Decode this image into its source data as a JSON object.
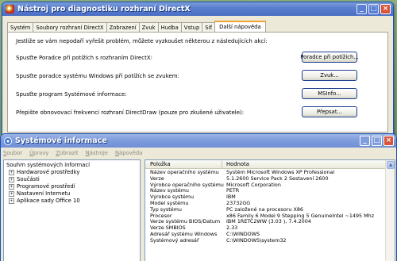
{
  "dx_window": {
    "title": "Nástroj pro diagnostiku rozhraní DirectX",
    "tabs": [
      "Systém",
      "Soubory rozhraní DirectX",
      "Zobrazení",
      "Zvuk",
      "Hudba",
      "Vstup",
      "Síť",
      "Další nápověda"
    ],
    "active_tab": "Další nápověda",
    "intro": "Jestliže se vám nepodaří vyřešit problém, můžete vyzkoušet některou z následujících akcí:",
    "rows": [
      {
        "label": "Spusťte Poradce při potížích s rozhraním DirectX:",
        "button": "Poradce při potížích..."
      },
      {
        "label": "Spusťte poradce systému Windows při potížích se zvukem:",
        "button": "Zvuk..."
      },
      {
        "label": "Spusťte program Systémové informace:",
        "button": "MSInfo..."
      },
      {
        "label": "Přepište obnovovací frekvenci rozhraní DirectDraw (pouze pro zkušené uživatele):",
        "button": "Přepsat..."
      }
    ]
  },
  "si_window": {
    "title": "Systémové informace",
    "menu": [
      "Soubor",
      "Úpravy",
      "Zobrazit",
      "Nástroje",
      "Nápověda"
    ],
    "tree": {
      "root": "Souhrn systémových informací",
      "children": [
        "Hardwarové prostředky",
        "Součásti",
        "Programové prostředí",
        "Nastavení Internetu",
        "Aplikace sady Office 10"
      ]
    },
    "columns": [
      "Položka",
      "Hodnota"
    ],
    "rows": [
      [
        "Název operačního systému",
        "Systém Microsoft Windows XP Professional"
      ],
      [
        "Verze",
        "5.1.2600 Service Pack 2 Sestavení 2600"
      ],
      [
        "Výrobce operačního systému",
        "Microsoft Corporation"
      ],
      [
        "Název systému",
        "PETR"
      ],
      [
        "Výrobce systému",
        "IBM"
      ],
      [
        "Model systému",
        "23732GG"
      ],
      [
        "Typ systému",
        "PC založené na procesoru X86"
      ],
      [
        "Procesor",
        "x86 Family 6 Model 9 Stepping 5 GenuineIntel ~1495 Mhz"
      ],
      [
        "Verze systému BIOS/Datum",
        "IBM 1RETC2WW (3.03 ), 7.4.2004"
      ],
      [
        "Verze SMBIOS",
        "2.33"
      ],
      [
        "Adresář systému Windows",
        "C:\\WINDOWS"
      ],
      [
        "Systémový adresář",
        "C:\\WINDOWS\\system32"
      ]
    ]
  },
  "icons": {
    "dx_app": "directx-icon",
    "si_app": "system-info-icon"
  },
  "colors": {
    "titlebar_active": "#4a6ec4",
    "titlebar_inactive": "#7f9ddc",
    "close_button": "#d8553a",
    "tab_highlight": "#f0a330"
  }
}
